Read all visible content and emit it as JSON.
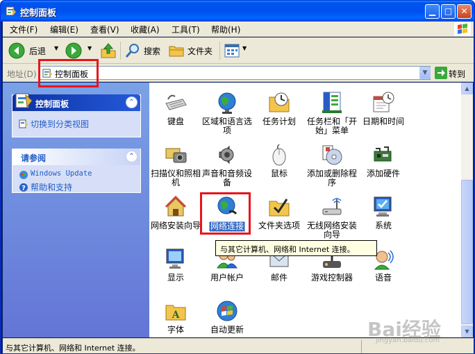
{
  "window": {
    "title": "控制面板"
  },
  "menubar": {
    "items": [
      "文件(F)",
      "编辑(E)",
      "查看(V)",
      "收藏(A)",
      "工具(T)",
      "帮助(H)"
    ]
  },
  "toolbar": {
    "back": "后退",
    "search": "搜索",
    "folders": "文件夹"
  },
  "address": {
    "label": "地址(D)",
    "value": "控制面板",
    "go": "转到"
  },
  "sidebar": {
    "panel1": {
      "title": "控制面板",
      "link": "切换到分类视图"
    },
    "panel2": {
      "title": "请参阅",
      "links": [
        "Windows Update",
        "帮助和支持"
      ]
    }
  },
  "items": [
    {
      "label": "键盘"
    },
    {
      "label": "区域和语言选项"
    },
    {
      "label": "任务计划"
    },
    {
      "label": "任务栏和「开始」菜单"
    },
    {
      "label": "日期和时间"
    },
    {
      "label": "扫描仪和照相机"
    },
    {
      "label": "声音和音频设备"
    },
    {
      "label": "鼠标"
    },
    {
      "label": "添加或删除程序"
    },
    {
      "label": "添加硬件"
    },
    {
      "label": "网络安装向导"
    },
    {
      "label": "网络连接"
    },
    {
      "label": "文件夹选项"
    },
    {
      "label": "无线网络安装向导"
    },
    {
      "label": "系统"
    },
    {
      "label": "显示"
    },
    {
      "label": "用户帐户"
    },
    {
      "label": "邮件"
    },
    {
      "label": "游戏控制器"
    },
    {
      "label": "语音"
    },
    {
      "label": "字体"
    },
    {
      "label": "自动更新"
    }
  ],
  "tooltip": "与其它计算机、网络和 Internet 连接。",
  "status": "与其它计算机、网络和 Internet 连接。",
  "watermark": {
    "logo": "Bai经验",
    "url": "jingyan.baidu.com"
  }
}
